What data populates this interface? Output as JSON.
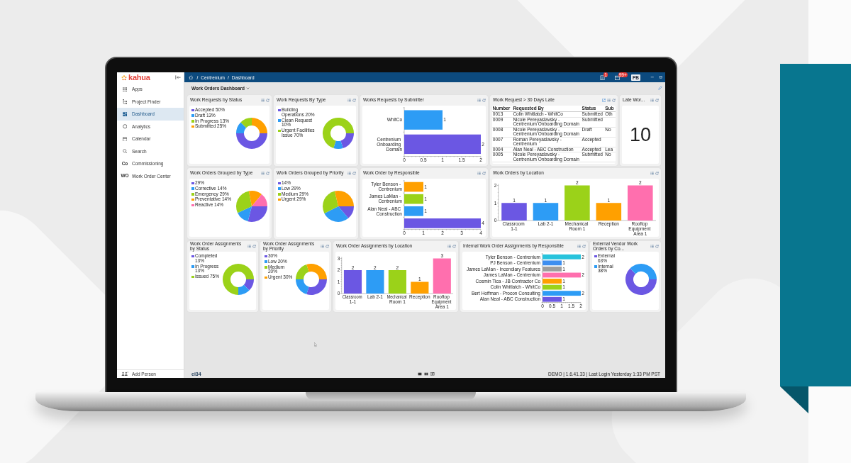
{
  "sidebar": {
    "logo": "kahua",
    "items": [
      {
        "label": "Apps",
        "selected": false
      },
      {
        "label": "Project Finder",
        "selected": false
      },
      {
        "label": "Dashboard",
        "selected": true
      },
      {
        "label": "Analytics",
        "selected": false
      },
      {
        "label": "Calendar",
        "selected": false
      },
      {
        "label": "Search",
        "selected": false
      },
      {
        "label": "Commissioning",
        "abbreviation": "Co",
        "selected": false
      },
      {
        "label": "Work Order Center",
        "abbreviation": "WO",
        "selected": false
      }
    ],
    "footer_action": "Add Person"
  },
  "header": {
    "breadcrumb": [
      {
        "separator": "/",
        "label": "Centrenium"
      },
      {
        "separator": "/",
        "label": "Dashboard"
      }
    ],
    "notifications": [
      {
        "badge": "1"
      },
      {
        "badge": "99+"
      }
    ],
    "user_initials": "PB"
  },
  "dashboard": {
    "title": "Work Orders Dashboard"
  },
  "widget_rows": [
    [
      {
        "kind": "chart",
        "title": "Work Requests by Status",
        "chart_data": {
          "type": "donut",
          "legend": "top-left",
          "categories": [
            "Accepted 50%",
            "Draft 13%",
            "In Progress 13%",
            "Submitted 25%"
          ],
          "values": [
            50,
            12.5,
            12.5,
            25
          ]
        }
      },
      {
        "kind": "chart",
        "title": "Work Requests By Type",
        "chart_data": {
          "type": "donut",
          "legend": "top-left",
          "categories": [
            "Building Operations 20%",
            "Clean Request 10%",
            "Urgent Facilities Issue 70%"
          ],
          "values": [
            20,
            10,
            70
          ]
        }
      },
      {
        "kind": "chart",
        "title": "Works Requests by Submitter",
        "chart_data": {
          "type": "bar",
          "orientation": "horizontal",
          "categories": [
            "WhitCo",
            "Centrenium Onboarding Domain"
          ],
          "values": [
            1,
            2
          ],
          "xlim": [
            0,
            2
          ],
          "xticks": [
            0,
            0.5,
            1,
            1.5,
            2
          ],
          "data_labels": true
        }
      },
      {
        "kind": "table",
        "title": "Work Request > 30 Days Late",
        "columns": [
          "Number",
          "Requested By",
          "Status",
          "Sub"
        ],
        "rows": [
          [
            "0013",
            "Colin Whitlatch - WhitCo",
            "Submitted",
            "Oth"
          ],
          [
            "0009",
            "Nicole Pereyaslavsky - Centrenium Onboarding Domain",
            "Submitted",
            null
          ],
          [
            "0008",
            "Nicole Pereyaslavsky - Centrenium Onboarding Domain",
            "Draft",
            "No"
          ],
          [
            "0007",
            "Roman Pereyaslavsky - Centrenium",
            "Accepted",
            null
          ],
          [
            "0004",
            "Alan Neal - ABC Construction",
            "Accepted",
            "Lea"
          ],
          [
            "0005",
            "Nicole Pereyaslavsky - Centrenium Onboarding Domain",
            "Submitted",
            "No"
          ]
        ]
      },
      {
        "kind": "metric",
        "title": "Late Wor...",
        "value": "10"
      }
    ],
    [
      {
        "kind": "chart",
        "title": "Work Orders Grouped by Type",
        "chart_data": {
          "type": "pie",
          "legend": "top-left",
          "categories": [
            "29%",
            "Corrective 14%",
            "Emergency 29%",
            "Preventative 14%",
            "Reactive 14%"
          ],
          "values": [
            29,
            14,
            29,
            14,
            14
          ]
        }
      },
      {
        "kind": "chart",
        "title": "Work Orders Grouped by Priority",
        "chart_data": {
          "type": "pie",
          "legend": "top-left",
          "categories": [
            "14%",
            "Low 29%",
            "Medium 29%",
            "Urgent 29%"
          ],
          "values": [
            14,
            29,
            29,
            29
          ]
        }
      },
      {
        "kind": "chart",
        "title": "Work Order by Responsible",
        "chart_data": {
          "type": "bar",
          "orientation": "horizontal",
          "categories": [
            "Tyler Benson - Centrenium",
            "James LaMan - Centrenium",
            "Alan Neal - ABC Construction",
            null
          ],
          "values": [
            1,
            1,
            1,
            4
          ],
          "xlim": [
            0,
            4
          ],
          "xticks": [
            0,
            1,
            2,
            3,
            4
          ],
          "data_labels": true
        }
      },
      {
        "kind": "chart",
        "title": "Work Orders by Location",
        "chart_data": {
          "type": "bar",
          "orientation": "vertical",
          "categories": [
            "Classroom 1-1",
            "Lab 2-1",
            "Mechanical Room 1",
            "Reception",
            "Rooftop Equipment Area 1"
          ],
          "values": [
            1,
            1,
            2,
            1,
            2
          ],
          "ylim": [
            0,
            2
          ],
          "yticks": [
            0,
            1,
            2
          ],
          "data_labels": true
        }
      }
    ],
    [
      {
        "kind": "chart",
        "title": "Work Order Assignments by Status",
        "chart_data": {
          "type": "donut",
          "legend": "top-left",
          "categories": [
            "Completed 13%",
            "In Progress 13%",
            "Issued 75%"
          ],
          "values": [
            12.5,
            12.5,
            75
          ]
        }
      },
      {
        "kind": "chart",
        "title": "Work Order Assignments by Priority",
        "chart_data": {
          "type": "donut",
          "legend": "top-left",
          "categories": [
            "30%",
            "Low 20%",
            "Medium 20%",
            "Urgent 30%"
          ],
          "values": [
            30,
            20,
            20,
            30
          ]
        }
      },
      {
        "kind": "chart",
        "title": "Work Order Assignments by Location",
        "chart_data": {
          "type": "bar",
          "orientation": "vertical",
          "categories": [
            "Classroom 1-1",
            "Lab 2-1",
            "Mechanical Room 1",
            "Reception",
            "Rooftop Equipment Area 1"
          ],
          "values": [
            2,
            2,
            2,
            1,
            3
          ],
          "ylim": [
            0,
            3
          ],
          "yticks": [
            0,
            1,
            2,
            3
          ],
          "data_labels": true
        }
      },
      {
        "kind": "chart",
        "title": "Internal Work Order Assignments by Responsible",
        "chart_data": {
          "type": "bar",
          "orientation": "horizontal",
          "categories": [
            "Tyler Benson - Centrenium",
            "PJ Benson - Centrenium",
            "James LaMan - Incendiary Features",
            "James LaMan - Centrenium",
            "Cosmin Tica - JB Contractor Co",
            "Colin Whitlatch - WhitCo",
            "Bert Hoffman - Procon Consulting",
            "Alan Neal - ABC Construction"
          ],
          "values": [
            2,
            1,
            1,
            2,
            1,
            1,
            2,
            1
          ],
          "xlim": [
            0,
            2
          ],
          "xticks": [
            0,
            0.5,
            1,
            1.5,
            2
          ],
          "data_labels": true
        }
      },
      {
        "kind": "chart",
        "title": "External Vendor Work Orders by Co...",
        "chart_data": {
          "type": "donut",
          "legend": "top-left",
          "categories": [
            "External 63%",
            "Internal 38%"
          ],
          "values": [
            62.5,
            37.5
          ]
        }
      }
    ]
  ],
  "status_bar": {
    "logo": "ei34",
    "text": "DEMO | 1.6.41.33 | Last Login Yesterday 1:33 PM PST"
  }
}
